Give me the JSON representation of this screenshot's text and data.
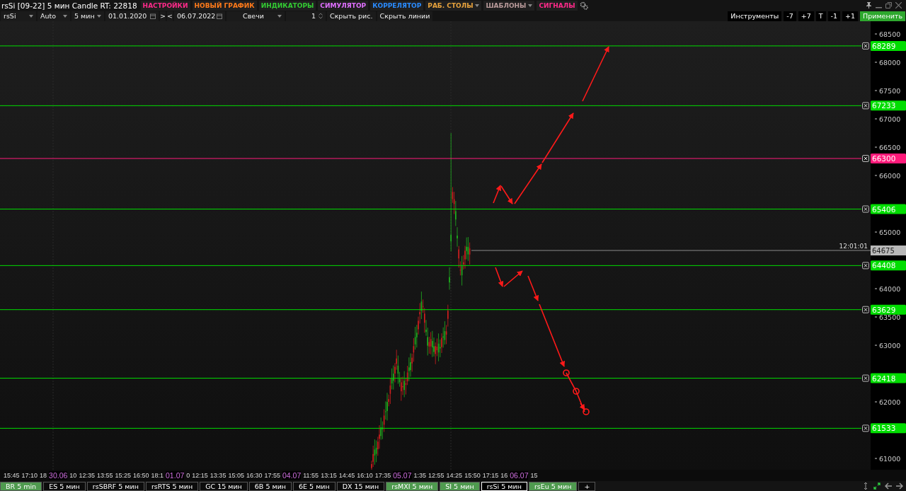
{
  "title": "rsSi [09-22] 5 мин Candle RT: 22818",
  "menu": [
    {
      "label": "НАСТРОЙКИ",
      "color": "#ff2a8a",
      "dropdown": false
    },
    {
      "label": "НОВЫЙ ГРАФИК",
      "color": "#ff7a1a",
      "dropdown": false
    },
    {
      "label": "ИНДИКАТОРЫ",
      "color": "#33cc33",
      "dropdown": false
    },
    {
      "label": "СИМУЛЯТОР",
      "color": "#e070ff",
      "dropdown": false
    },
    {
      "label": "КОРРЕЛЯТОР",
      "color": "#2a8cff",
      "dropdown": false
    },
    {
      "label": "РАБ. СТОЛЫ",
      "color": "#e8a33d",
      "dropdown": true
    },
    {
      "label": "ШАБЛОНЫ",
      "color": "#b89a9a",
      "dropdown": true
    },
    {
      "label": "СИГНАЛЫ",
      "color": "#ff2a8a",
      "dropdown": false
    }
  ],
  "toolbar": {
    "symbol": "rsSi",
    "scale": "Auto",
    "timeframe": "5 мин",
    "date_from": "01.01.2020",
    "next": ">",
    "prev": "<",
    "date_to": "06.07.2022",
    "chart_type": "Свечи",
    "count": "1",
    "hide_drawings": "Скрыть рис.",
    "hide_lines": "Скрыть линии"
  },
  "tools": [
    {
      "label": "Инструменты",
      "kind": "plain"
    },
    {
      "label": "-7",
      "kind": "plain"
    },
    {
      "label": "+7",
      "kind": "plain"
    },
    {
      "label": "T",
      "kind": "plain"
    },
    {
      "label": "-1",
      "kind": "plain"
    },
    {
      "label": "+1",
      "kind": "plain"
    },
    {
      "label": "Применить",
      "kind": "apply"
    }
  ],
  "chart": {
    "price_ticks": [
      "68500",
      "68000",
      "67500",
      "67000",
      "66500",
      "66000",
      "65000",
      "64000",
      "63500",
      "63000",
      "62000",
      "61000"
    ],
    "levels": [
      {
        "price": "68289",
        "color": "#00dd00"
      },
      {
        "price": "67233",
        "color": "#00dd00"
      },
      {
        "price": "66300",
        "color": "#ff1a7a"
      },
      {
        "price": "65406",
        "color": "#00dd00"
      },
      {
        "price": "64408",
        "color": "#00dd00"
      },
      {
        "price": "63629",
        "color": "#00dd00"
      },
      {
        "price": "62418",
        "color": "#00dd00"
      },
      {
        "price": "61533",
        "color": "#00dd00"
      }
    ],
    "current": {
      "price": "64675",
      "time": "12:01:01"
    }
  },
  "time_axis": [
    {
      "label": "15:45",
      "kind": "time"
    },
    {
      "label": "17:10",
      "kind": "time"
    },
    {
      "label": "18",
      "kind": "time"
    },
    {
      "label": "30.06",
      "kind": "date"
    },
    {
      "label": "10",
      "kind": "time"
    },
    {
      "label": "12:35",
      "kind": "time"
    },
    {
      "label": "13:55",
      "kind": "time"
    },
    {
      "label": "15:25",
      "kind": "time"
    },
    {
      "label": "16:50",
      "kind": "time"
    },
    {
      "label": "18:1",
      "kind": "time"
    },
    {
      "label": "01.07",
      "kind": "date"
    },
    {
      "label": "0",
      "kind": "time"
    },
    {
      "label": "12:15",
      "kind": "time"
    },
    {
      "label": "13:35",
      "kind": "time"
    },
    {
      "label": "15:05",
      "kind": "time"
    },
    {
      "label": "16:30",
      "kind": "time"
    },
    {
      "label": "17:55",
      "kind": "time"
    },
    {
      "label": "04.07",
      "kind": "date"
    },
    {
      "label": "11:55",
      "kind": "time"
    },
    {
      "label": "13:15",
      "kind": "time"
    },
    {
      "label": "14:45",
      "kind": "time"
    },
    {
      "label": "16:10",
      "kind": "time"
    },
    {
      "label": "17:35",
      "kind": "time"
    },
    {
      "label": "05.07",
      "kind": "date"
    },
    {
      "label": "1:35",
      "kind": "time"
    },
    {
      "label": "12:55",
      "kind": "time"
    },
    {
      "label": "14:25",
      "kind": "time"
    },
    {
      "label": "15:50",
      "kind": "time"
    },
    {
      "label": "17:15",
      "kind": "time"
    },
    {
      "label": "16",
      "kind": "time"
    },
    {
      "label": "06.07",
      "kind": "date"
    },
    {
      "label": "15",
      "kind": "time"
    }
  ],
  "tabs": [
    {
      "label": "BR 5 min",
      "highlighted": true,
      "selected": false
    },
    {
      "label": "ES 5 мин",
      "highlighted": false,
      "selected": false
    },
    {
      "label": "rsSBRF 5 мин",
      "highlighted": false,
      "selected": false
    },
    {
      "label": "rsRTS 5 мин",
      "highlighted": false,
      "selected": false
    },
    {
      "label": "GC 15 мин",
      "highlighted": false,
      "selected": false
    },
    {
      "label": "6B 5 мин",
      "highlighted": false,
      "selected": false
    },
    {
      "label": "6E 5 мин",
      "highlighted": false,
      "selected": false
    },
    {
      "label": "DX 15 мин",
      "highlighted": false,
      "selected": false
    },
    {
      "label": "rsMXI 5 мин",
      "highlighted": true,
      "selected": false
    },
    {
      "label": "SI 5 мин",
      "highlighted": true,
      "selected": false
    },
    {
      "label": "rsSi 5 мин",
      "highlighted": false,
      "selected": true
    },
    {
      "label": "rsEu 5 мин",
      "highlighted": true,
      "selected": false
    }
  ],
  "add_tab": "+"
}
